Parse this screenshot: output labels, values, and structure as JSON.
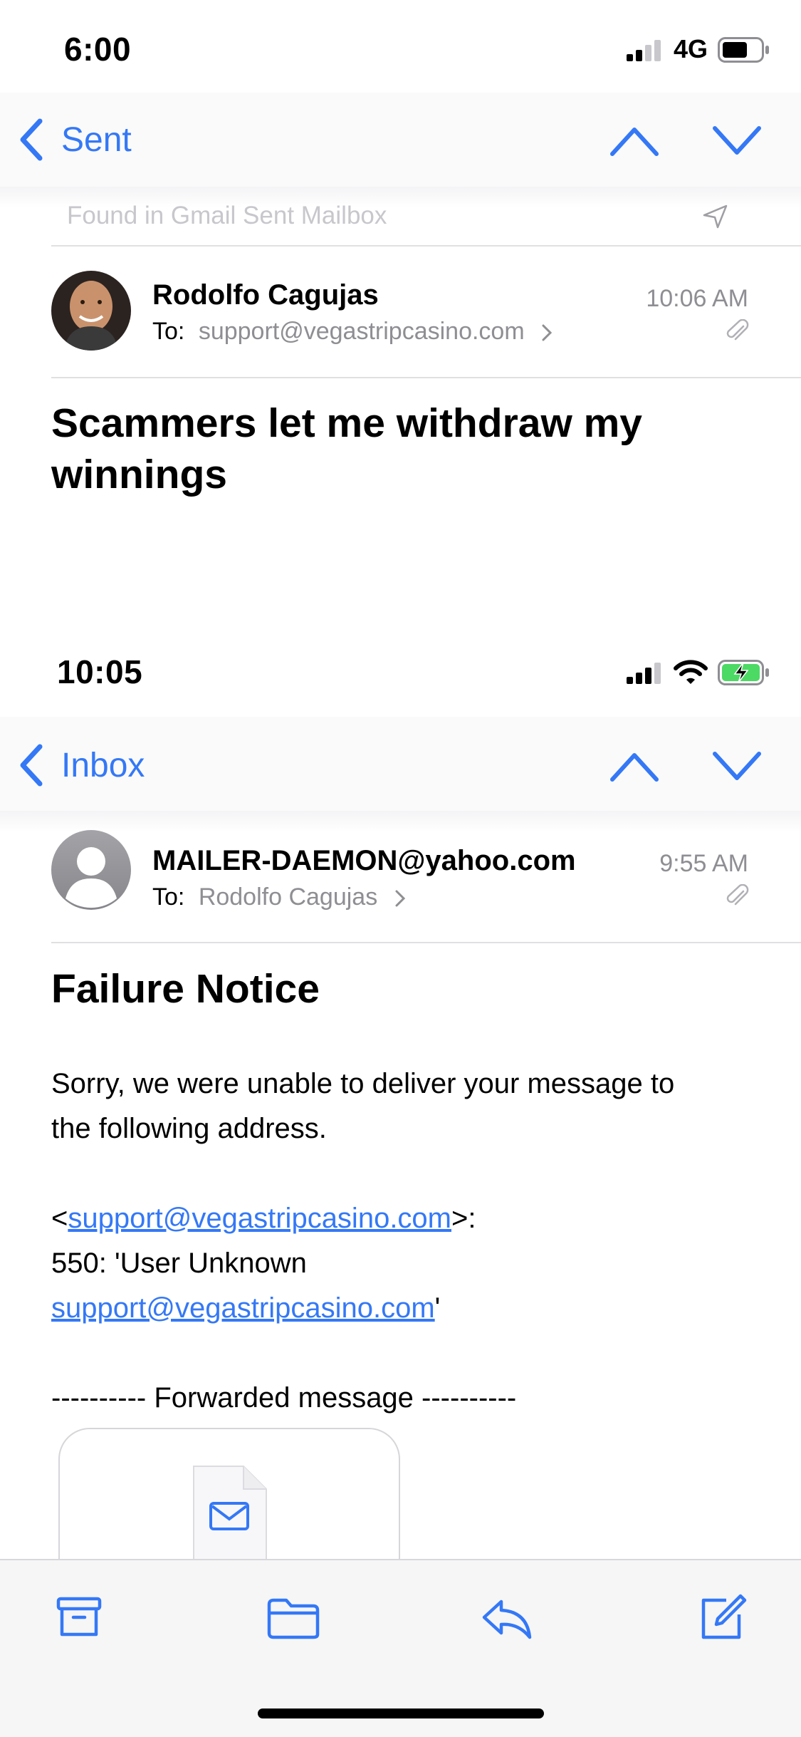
{
  "top": {
    "status": {
      "time": "6:00",
      "network": "4G"
    },
    "nav": {
      "back_label": "Sent"
    },
    "found_in": "Found in Gmail Sent Mailbox",
    "message": {
      "sender": "Rodolfo  Cagujas",
      "to_label": "To:",
      "to_value": "support@vegastripcasino.com",
      "time": "10:06 AM",
      "subject": "Scammers let me withdraw my winnings"
    }
  },
  "bottom": {
    "status": {
      "time": "10:05"
    },
    "nav": {
      "back_label": "Inbox"
    },
    "message": {
      "sender": "MAILER-DAEMON@yahoo.com",
      "to_label": "To:",
      "to_value": "Rodolfo  Cagujas",
      "time": "9:55 AM",
      "subject": "Failure Notice",
      "body_line1": "Sorry, we were unable to deliver your message to",
      "body_line2": "the following address.",
      "addr_prefix": "<",
      "addr_link": "support@vegastripcasino.com",
      "addr_suffix": ">:",
      "error_line": "550: 'User Unknown",
      "error_link": "support@vegastripcasino.com",
      "error_suffix": "'",
      "forwarded": "---------- Forwarded message ----------"
    }
  },
  "toolbar": {
    "icons": [
      "archive-icon",
      "folder-icon",
      "reply-icon",
      "compose-icon"
    ]
  },
  "colors": {
    "accent": "#3478f6",
    "battery_charging": "#4cd964"
  }
}
